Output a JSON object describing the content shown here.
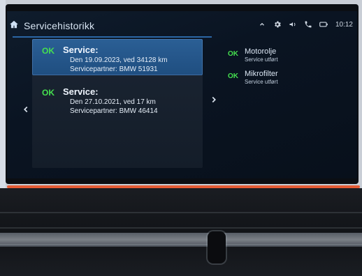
{
  "screen": {
    "title": "Servicehistorikk",
    "status": {
      "time": "10:12"
    },
    "left_list": [
      {
        "status": "OK",
        "heading": "Service:",
        "line1": "Den 19.09.2023, ved 34128 km",
        "line2": "Servicepartner: BMW 51931"
      },
      {
        "status": "OK",
        "heading": "Service:",
        "line1": "Den 27.10.2021, ved 17 km",
        "line2": "Servicepartner: BMW 46414"
      }
    ],
    "right_list": [
      {
        "status": "OK",
        "title": "Motorolje",
        "subtitle": "Service utført"
      },
      {
        "status": "OK",
        "title": "Mikrofilter",
        "subtitle": "Service utført"
      }
    ]
  },
  "icons": {
    "home": "home-icon",
    "nav_prev": "chevron-left-icon",
    "nav_next": "chevron-right-icon",
    "chevron_up": "chevron-up-icon",
    "settings": "settings-icon",
    "volume": "volume-icon",
    "phone": "phone-icon",
    "battery": "battery-icon"
  }
}
